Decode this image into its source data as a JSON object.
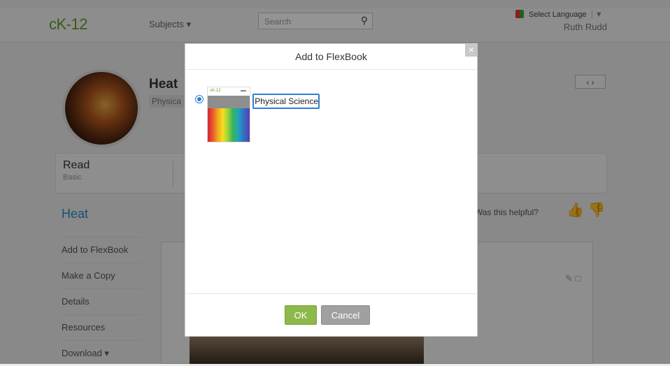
{
  "header": {
    "logo": "cK-12",
    "subjects_label": "Subjects",
    "subjects_caret": "▾",
    "search_placeholder": "Search",
    "language_label": "Select Language",
    "language_caret": "▼",
    "user_name": "Ruth Rudd"
  },
  "concept": {
    "title": "Heat",
    "subject_tag": "Physica",
    "nav_arrows": "‹ ›"
  },
  "read_bar": {
    "title": "Read",
    "level": "Basic"
  },
  "content": {
    "heading": "Heat",
    "helpful_text": "Was this helpful?"
  },
  "sidebar": {
    "items": [
      {
        "label": "Add to FlexBook"
      },
      {
        "label": "Make a Copy"
      },
      {
        "label": "Details"
      },
      {
        "label": "Resources"
      },
      {
        "label": "Download ▾"
      }
    ]
  },
  "modal": {
    "title": "Add to FlexBook",
    "close_glyph": "×",
    "book_name_value": "Physical Science",
    "ok_label": "OK",
    "cancel_label": "Cancel",
    "cover_logo": "cK-12"
  },
  "colors": {
    "ck12_green": "#5aa02c",
    "ck12_blue": "#2b89c8",
    "ok_green": "#8db84a",
    "cancel_gray": "#a0a0a0",
    "focus_blue": "#2b7fd4"
  }
}
